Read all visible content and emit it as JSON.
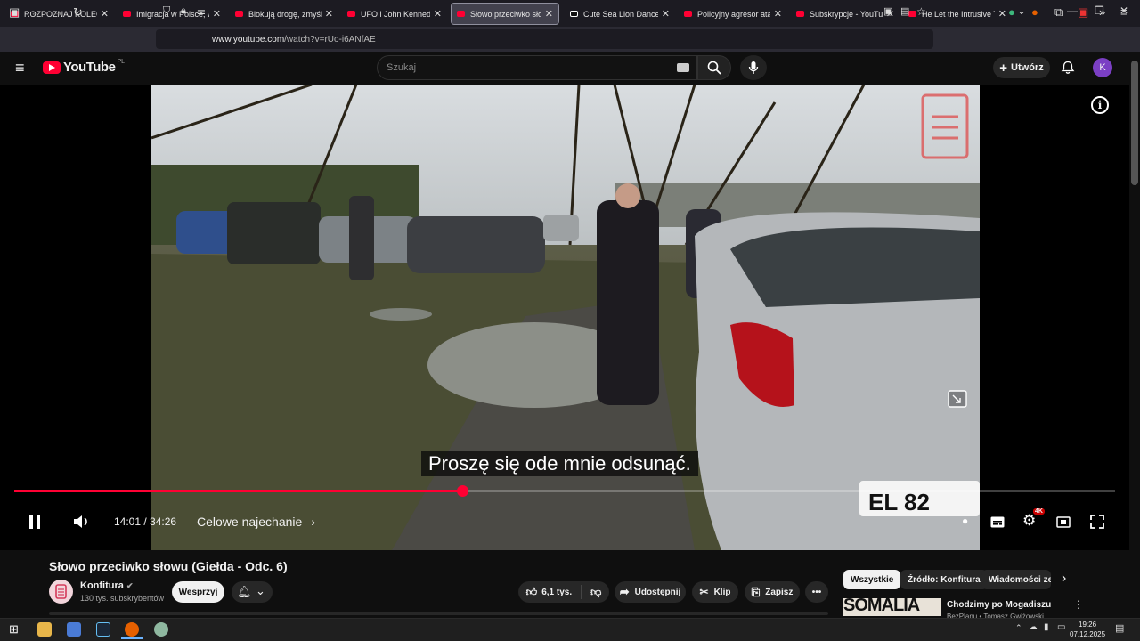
{
  "tabs": [
    {
      "title": "ROZPOZNAJ KOLEGĘ PO",
      "icon": "youtube-icon"
    },
    {
      "title": "Imigracja w Polsce, wsch",
      "icon": "youtube-icon"
    },
    {
      "title": "Blokują drogę, zmyślają",
      "icon": "youtube-icon"
    },
    {
      "title": "UFO i John Kennedy - Po",
      "icon": "youtube-icon"
    },
    {
      "title": "Słowo przeciwko sło",
      "icon": "youtube-icon",
      "active": true
    },
    {
      "title": "Cute Sea Lion Dance Cor",
      "icon": "tiktok-icon"
    },
    {
      "title": "Policyjny agresor atakuje",
      "icon": "youtube-icon"
    },
    {
      "title": "Subskrypcje - YouTube",
      "icon": "youtube-icon"
    },
    {
      "title": "He Let the Intrusive Thou",
      "icon": "youtube-icon"
    }
  ],
  "browser": {
    "url_domain": "www.youtube.com",
    "url_path": "/watch?v=rUo-i6ANfAE"
  },
  "youtube": {
    "logo_text": "YouTube",
    "logo_region": "PL",
    "search_placeholder": "Szukaj",
    "create_label": "Utwórz",
    "avatar_letter": "K"
  },
  "player": {
    "subtitle": "Proszę się ode mnie odsunąć.",
    "current_time": "14:01",
    "duration": "34:26",
    "time_display": "14:01 / 34:26",
    "progress_fraction": 0.407,
    "chapter": "Celowe najechanie",
    "quality_badge": "4K"
  },
  "video_info": {
    "title": "Słowo przeciwko słowu (Giełda - Odc. 6)",
    "channel": "Konfitura",
    "subscribers": "130 tys. subskrybentów",
    "support_label": "Wesprzyj",
    "likes": "6,1 tys.",
    "share_label": "Udostępnij",
    "clip_label": "Klip",
    "save_label": "Zapisz"
  },
  "chips": [
    "Wszystkie",
    "Źródło: Konfitura",
    "Wiadomości ze"
  ],
  "recommendation": {
    "thumb_text": "SOMALIA",
    "title": "Chodzimy po Mogadiszu",
    "meta": "BezPlanu • Tomasz Gwiżowski"
  },
  "clock": {
    "time": "19:26",
    "date": "07.12.2025"
  },
  "colors": {
    "accent": "#ff0033",
    "background": "#0f0f0f",
    "chip_selected": "#f1f1f1"
  }
}
